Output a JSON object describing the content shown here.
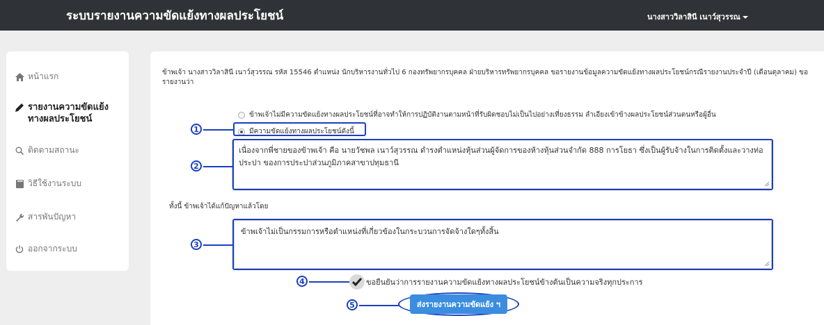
{
  "navbar": {
    "title": "ระบบรายงานความขัดแย้งทางผลประโยชน์",
    "user_name": "นางสาววิลาสินี เนาว์สุวรรณ"
  },
  "sidebar": {
    "items": [
      {
        "label": "หน้าแรก",
        "icon": "home-icon"
      },
      {
        "label": "รายงานความขัดแย้งทางผลประโยชน์",
        "icon": "pencil-icon"
      },
      {
        "label": "ติดตามสถานะ",
        "icon": "search-icon"
      },
      {
        "label": "วิธีใช้งานระบบ",
        "icon": "book-icon"
      },
      {
        "label": "สารพันปัญหา",
        "icon": "wrench-icon"
      },
      {
        "label": "ออกจากระบบ",
        "icon": "power-icon"
      }
    ]
  },
  "form": {
    "intro": "ข้าพเจ้า นางสาววิลาสินี เนาว์สุวรรณ รหัส 15546 ตำแหน่ง นักบริหารงานทั่วไป 6 กองทรัพยากรบุคคล ฝ่ายบริหารทรัพยากรบุคคล ขอรายงานข้อมูลความขัดแย้งทางผลประโยชน์กรณีรายงานประจำปี (เดือนตุลาคม) ขอรายงานว่า",
    "option_none": "ข้าพเจ้าไม่มีความขัดแย้งทางผลประโยชน์ที่อาจทำให้การปฏิบัติงานตามหน้าที่รับผิดชอบไม่เป็นไปอย่างเที่ยงธรรม ลำเอียงเข้าข้างผลประโยชน์ส่วนตนหรือผู้อื่น",
    "option_has": "มีความขัดแย้งทางผลประโยชน์ดังนี้",
    "detail_text": "เนื่องจากพี่ชายของข้าพเจ้า คือ นายวัชพล เนาว์สุวรรณ ดำรงตำแหน่งหุ้นส่วนผู้จัดการของห้างหุ้นส่วนจำกัด 888 การโยธา ซึ่งเป็นผู้รับจ้างในการติดตั้งและวางท่อประปา ของการประปาส่วนภูมิภาคสาขาปทุมธานี",
    "resolution_label": "ทั้งนี้ ข้าพเจ้าได้แก้ปัญหาแล้วโดย",
    "resolution_text": "ข้าพเจ้าไม่เป็นกรรมการหรือตำแหน่งที่เกี่ยวข้องในกระบวนการจัดจ้างใดๆทั้งสิ้น",
    "confirm_text": "ขอยืนยันว่าการรายงานความขัดแย้งทางผลประโยชน์ข้างต้นเป็นความจริงทุกประการ",
    "submit_label": "ส่งรายงานความขัดแย้ง ฯ"
  },
  "callouts": [
    "1",
    "2",
    "3",
    "4",
    "5"
  ],
  "colors": {
    "navbar_bg": "#2f3236",
    "callout_blue": "#1a3fbf",
    "button_blue": "#3b8de0"
  }
}
